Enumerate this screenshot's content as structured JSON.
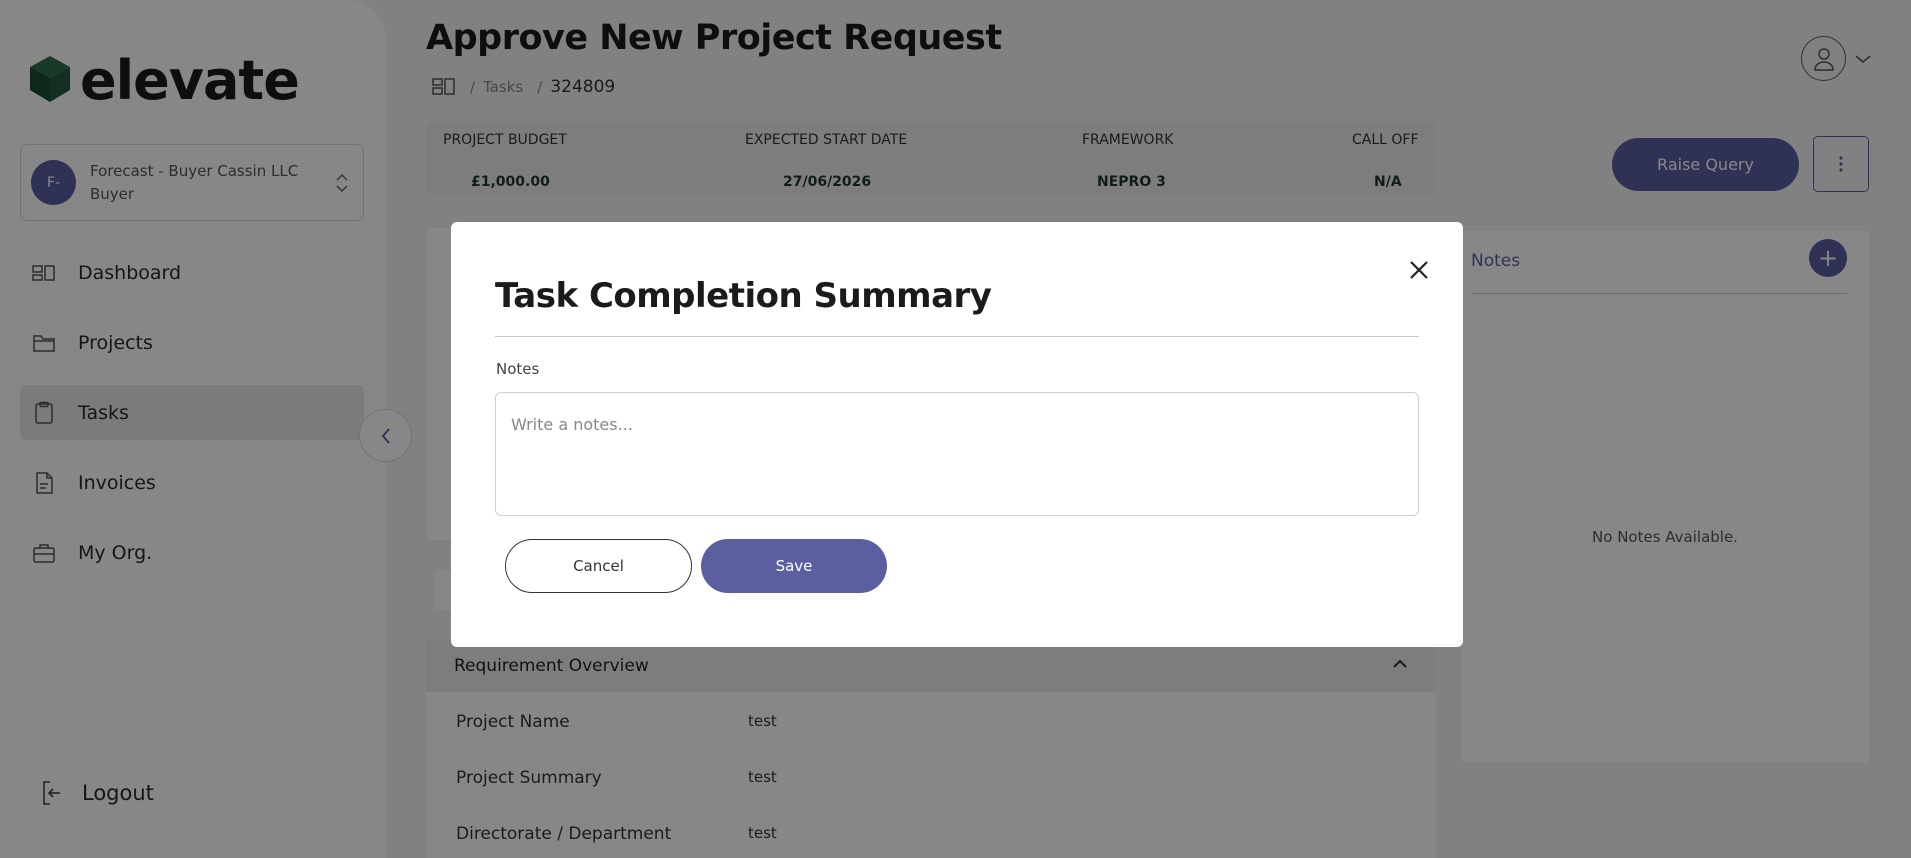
{
  "app": {
    "brand": "elevate"
  },
  "org": {
    "avatar_initials": "F-",
    "name": "Forecast - Buyer Cassin LLC",
    "role": "Buyer"
  },
  "sidebar": {
    "items": [
      {
        "label": "Dashboard",
        "icon": "dashboard-icon",
        "active": false
      },
      {
        "label": "Projects",
        "icon": "folder-icon",
        "active": false
      },
      {
        "label": "Tasks",
        "icon": "clipboard-icon",
        "active": true
      },
      {
        "label": "Invoices",
        "icon": "document-icon",
        "active": false
      },
      {
        "label": "My Org.",
        "icon": "briefcase-icon",
        "active": false
      }
    ],
    "logout_label": "Logout"
  },
  "header": {
    "title": "Approve New Project Request",
    "breadcrumb": {
      "separator": "/",
      "section": "Tasks",
      "current": "324809"
    }
  },
  "summary": {
    "budget_label": "PROJECT BUDGET",
    "budget_value": "£1,000.00",
    "start_label": "EXPECTED START DATE",
    "start_value": "27/06/2026",
    "framework_label": "FRAMEWORK",
    "framework_value": "NEPRO 3",
    "calloff_label": "CALL OFF",
    "calloff_value": "N/A"
  },
  "actions": {
    "raise_query_label": "Raise Query"
  },
  "notes_panel": {
    "title": "Notes",
    "add_label": "+",
    "empty_text": "No Notes Available."
  },
  "requirement": {
    "title": "Requirement Overview",
    "rows": [
      {
        "key": "Project Name",
        "value": "test"
      },
      {
        "key": "Project Summary",
        "value": "test"
      },
      {
        "key": "Directorate / Department",
        "value": "test"
      }
    ]
  },
  "modal": {
    "title": "Task Completion Summary",
    "notes_label": "Notes",
    "notes_placeholder": "Write a notes...",
    "notes_value": "",
    "cancel_label": "Cancel",
    "save_label": "Save"
  },
  "colors": {
    "accent": "#5b5fa0",
    "brand_dark": "#1c4a33",
    "brand_light": "#2e6e4a",
    "overlay": "rgba(0,0,0,0.47)"
  }
}
